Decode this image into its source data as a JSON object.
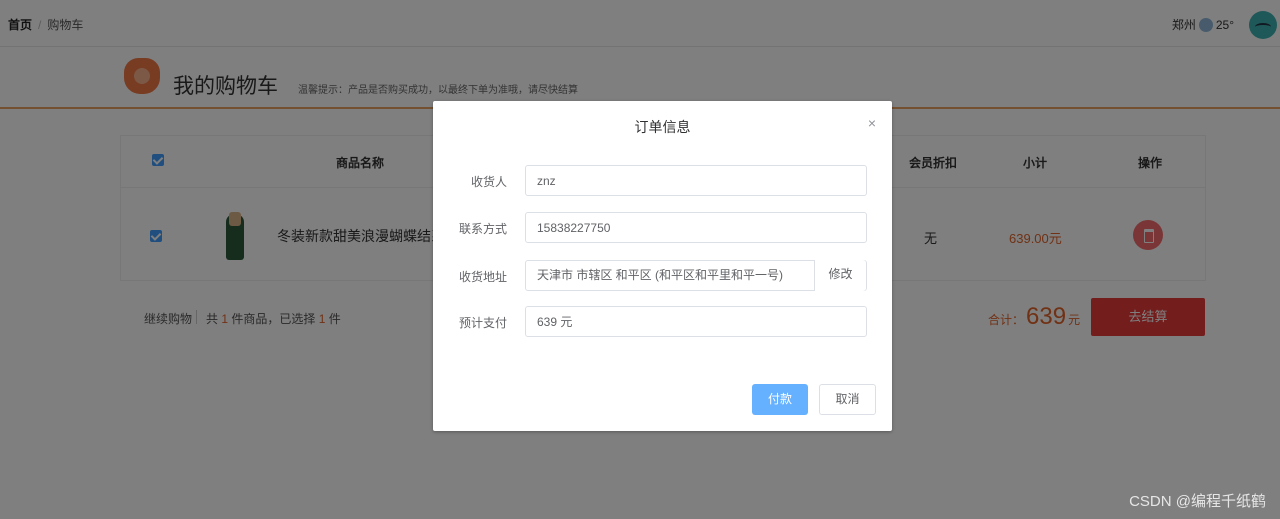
{
  "breadcrumb": {
    "home": "首页",
    "sep": "/",
    "current": "购物车"
  },
  "weather": {
    "city": "郑州",
    "temp": "25°"
  },
  "cart_header": {
    "title": "我的购物车",
    "tip": "温馨提示：产品是否购买成功，以最终下单为准哦，请尽快结算"
  },
  "table": {
    "columns": {
      "name": "商品名称",
      "discount": "会员折扣",
      "subtotal": "小计",
      "action": "操作"
    },
    "row": {
      "product_name": "冬装新款甜美浪漫蝴蝶结系",
      "discount": "无",
      "subtotal": "639.00元"
    }
  },
  "footer": {
    "continue": "继续购物",
    "count_prefix": "共",
    "count_total": "1",
    "count_mid": "件商品，已选择",
    "count_selected": "1",
    "count_suffix": "件",
    "total_label": "合计：",
    "total_value": "639",
    "total_unit": "元",
    "checkout": "去结算"
  },
  "dialog": {
    "title": "订单信息",
    "close": "×",
    "fields": {
      "receiver_label": "收货人",
      "receiver_value": "znz",
      "contact_label": "联系方式",
      "contact_value": "15838227750",
      "address_label": "收货地址",
      "address_value": "天津市 市辖区 和平区 (和平区和平里和平一号)",
      "address_edit": "修改",
      "pay_label": "预计支付",
      "pay_value": "639 元"
    },
    "pay_button": "付款",
    "cancel_button": "取消"
  },
  "watermark": "CSDN @编程千纸鹤",
  "colors": {
    "primary": "#409eff",
    "danger": "#f56c6c",
    "accent": "#e0632a"
  }
}
